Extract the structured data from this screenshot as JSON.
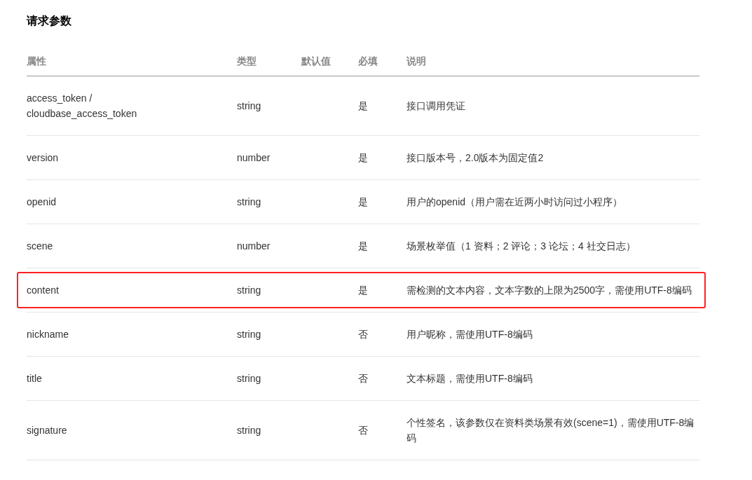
{
  "title": "请求参数",
  "table": {
    "columns": [
      "属性",
      "类型",
      "默认值",
      "必填",
      "说明"
    ],
    "rows": [
      {
        "name": "access_token / cloudbase_access_token",
        "type": "string",
        "required": "是",
        "description": "接口调用凭证",
        "highlighted": false
      },
      {
        "name": "version",
        "type": "number",
        "required": "是",
        "description": "接口版本号，2.0版本为固定值2",
        "highlighted": false
      },
      {
        "name": "openid",
        "type": "string",
        "required": "是",
        "description": "用户的openid（用户需在近两小时访问过小程序）",
        "highlighted": false
      },
      {
        "name": "scene",
        "type": "number",
        "required": "是",
        "description": "场景枚举值（1 资料；2 评论；3 论坛；4 社交日志）",
        "highlighted": false
      },
      {
        "name": "content",
        "type": "string",
        "required": "是",
        "description": "需检测的文本内容，文本字数的上限为2500字，需使用UTF-8编码",
        "highlighted": true
      },
      {
        "name": "nickname",
        "type": "string",
        "required": "否",
        "description": "用户昵称，需使用UTF-8编码",
        "highlighted": false
      },
      {
        "name": "title",
        "type": "string",
        "required": "否",
        "description": "文本标题，需使用UTF-8编码",
        "highlighted": false
      },
      {
        "name": "signature",
        "type": "string",
        "required": "否",
        "description": "个性签名，该参数仅在资料类场景有效(scene=1)，需使用UTF-8编码",
        "highlighted": false
      }
    ]
  }
}
